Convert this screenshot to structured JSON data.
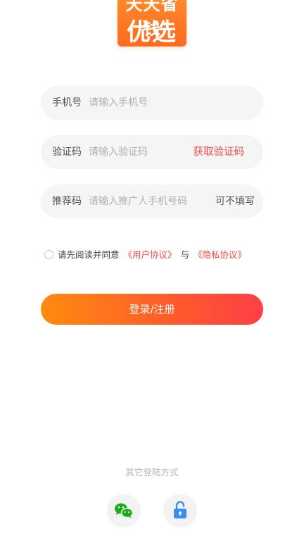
{
  "logo": {
    "line1": "天天省钱",
    "line2": "优选"
  },
  "form": {
    "phone": {
      "label": "手机号",
      "placeholder": "请输入手机号"
    },
    "code": {
      "label": "验证码",
      "placeholder": "请输入验证码",
      "action": "获取验证码"
    },
    "referrer": {
      "label": "推荐码",
      "placeholder": "请输入推广人手机号码",
      "hint": "可不填写"
    }
  },
  "agreement": {
    "prefix": "请先阅读并同意",
    "user_agreement": "《用户协议》",
    "and": "与",
    "privacy_agreement": "《隐私协议》",
    "checked": false
  },
  "login_button": "登录/注册",
  "other_login": {
    "title": "其它登陆方式",
    "icons": [
      "wechat-icon",
      "lock-icon"
    ]
  },
  "colors": {
    "accent_red": "#f24a41",
    "button_start": "#ff8c0e",
    "button_end": "#ff3f45",
    "wechat_green": "#1aad19",
    "lock_blue": "#3b8ef0"
  }
}
